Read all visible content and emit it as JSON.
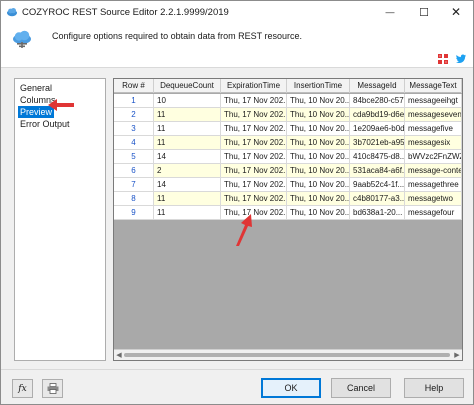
{
  "window": {
    "title": "COZYROC REST Source Editor 2.2.1.9999/2019",
    "minimize": "—",
    "maximize": "☐",
    "close": "✕"
  },
  "header": {
    "description": "Configure options required to obtain data from REST resource."
  },
  "nav": {
    "items": [
      {
        "label": "General",
        "selected": false
      },
      {
        "label": "Columns",
        "selected": false
      },
      {
        "label": "Preview",
        "selected": true
      },
      {
        "label": "Error Output",
        "selected": false
      }
    ]
  },
  "grid": {
    "columns": [
      "Row #",
      "DequeueCount",
      "ExpirationTime",
      "InsertionTime",
      "MessageId",
      "MessageText"
    ],
    "rows": [
      [
        "1",
        "10",
        "Thu, 17 Nov 202...",
        "Thu, 10 Nov 20...",
        "84bce280-c57...",
        "messageeihgt"
      ],
      [
        "2",
        "11",
        "Thu, 17 Nov 202...",
        "Thu, 10 Nov 20...",
        "cda9bd19-d6e...",
        "messageseven"
      ],
      [
        "3",
        "11",
        "Thu, 17 Nov 202...",
        "Thu, 10 Nov 20...",
        "1e209ae6-b0d...",
        "messagefive"
      ],
      [
        "4",
        "11",
        "Thu, 17 Nov 202...",
        "Thu, 10 Nov 20...",
        "3b7021eb-a95...",
        "messagesix"
      ],
      [
        "5",
        "14",
        "Thu, 17 Nov 202...",
        "Thu, 10 Nov 20...",
        "410c8475-d8...",
        "bWVzc2FnZWZv"
      ],
      [
        "6",
        "2",
        "Thu, 17 Nov 202...",
        "Thu, 10 Nov 20...",
        "531aca84-a6f...",
        "message-content"
      ],
      [
        "7",
        "14",
        "Thu, 17 Nov 202...",
        "Thu, 10 Nov 20...",
        "9aab52c4-1f...",
        "messagethree"
      ],
      [
        "8",
        "11",
        "Thu, 17 Nov 202...",
        "Thu, 10 Nov 20...",
        "c4b80177-a3...",
        "messagetwo"
      ],
      [
        "9",
        "11",
        "Thu, 17 Nov 202...",
        "Thu, 10 Nov 20...",
        "bd638a1-20...",
        "messagefour"
      ]
    ]
  },
  "footer": {
    "fx_label": "fx",
    "ok_label": "OK",
    "cancel_label": "Cancel",
    "help_label": "Help"
  },
  "colors": {
    "accent": "#0078d7",
    "arrow": "#e03535",
    "alt_row": "#ffffe0"
  }
}
